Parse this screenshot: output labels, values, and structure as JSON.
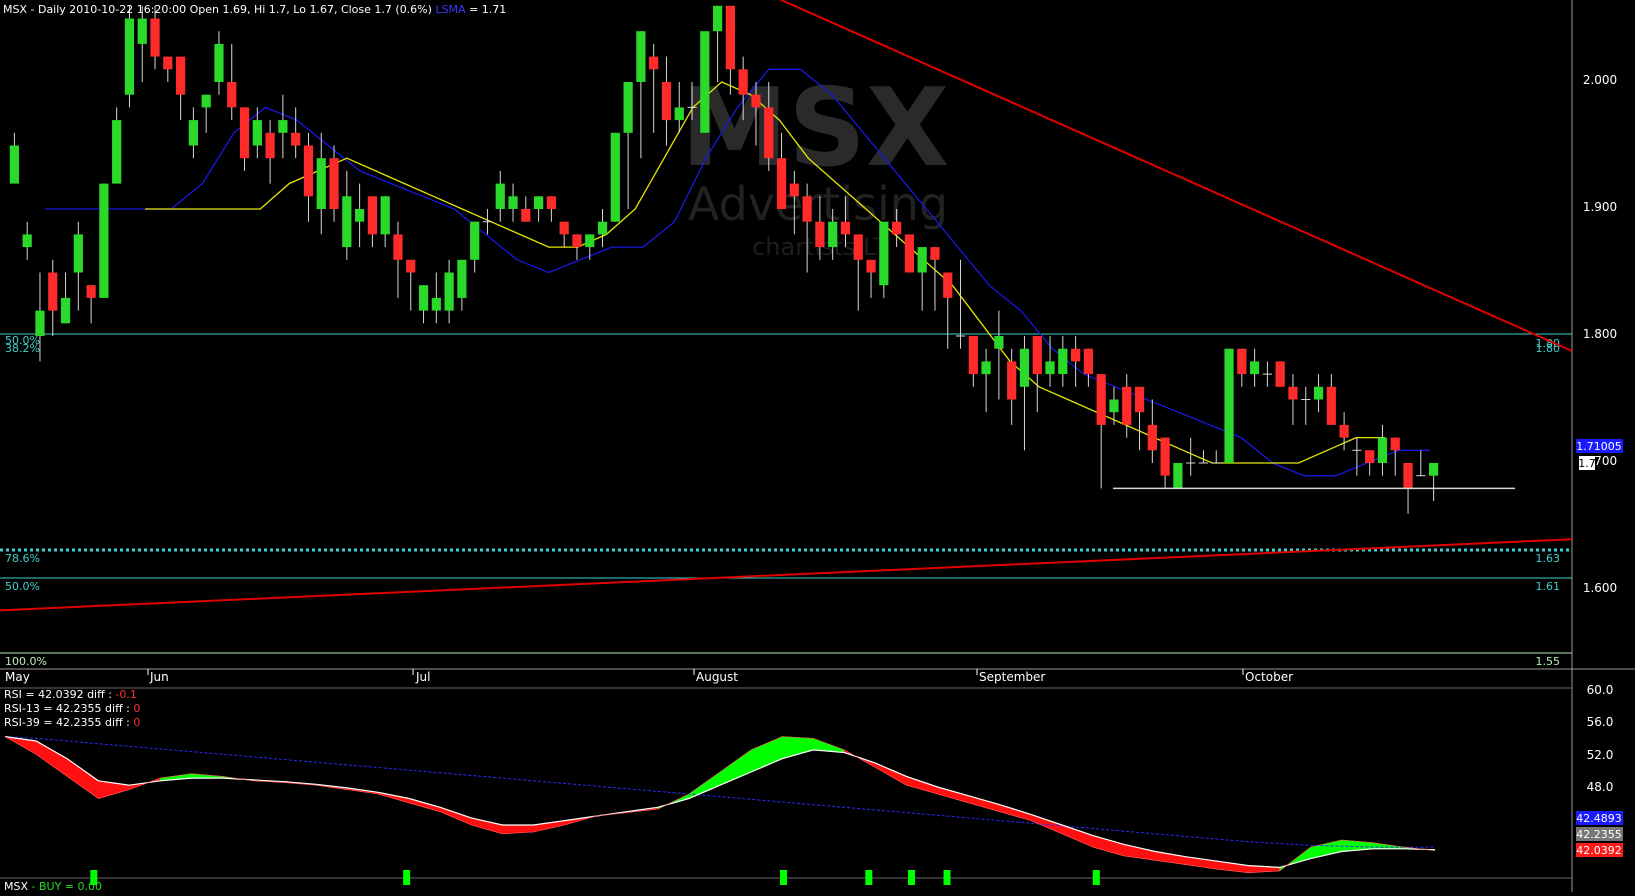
{
  "header": {
    "prefix": "MSX - Daily 2010-10-22 16:20:00 Open 1.69, Hi 1.7, Lo 1.67, Close 1.7 (0.6%)",
    "ma_label": "LSMA",
    "ma_value": "= 1.71"
  },
  "watermark": {
    "ticker": "MSX",
    "company": "Advertising",
    "source": "chartists.LT"
  },
  "colors": {
    "bull": "#2bd92b",
    "bear": "#ff2a2a",
    "ma_slow": "#1818e0",
    "ma_fast": "#e6e600",
    "trend": "#e00000",
    "fib": "#3fd0d0",
    "rsi_up": "#00ff00",
    "rsi_down": "#ff1010"
  },
  "price_axis": {
    "ticks": [
      "2.000",
      "1.900",
      "1.800",
      "1.700",
      "1.600"
    ],
    "badge_ma": "1.71005",
    "badge_close": "1.7"
  },
  "months": [
    "May",
    "Jun",
    "Jul",
    "August",
    "September",
    "October"
  ],
  "fib_levels": [
    {
      "label": "50.0%",
      "label2": "38.2%",
      "value": "1.80"
    },
    {
      "label": "78.6%",
      "value": "1.63"
    },
    {
      "label": "50.0%",
      "value": "1.61"
    },
    {
      "label": "100.0%",
      "value": "1.55"
    }
  ],
  "rsi": {
    "lines": [
      {
        "name": "RSI = 42.0392",
        "diff_label": "diff :",
        "diff": "-0.1"
      },
      {
        "name": "RSI-13 = 42.2355",
        "diff_label": "diff :",
        "diff": "0"
      },
      {
        "name": "RSI-39 = 42.2355",
        "diff_label": "diff :",
        "diff": "0"
      }
    ],
    "ticks": [
      "60.0",
      "56.0",
      "52.0",
      "48.0"
    ],
    "badges": [
      "42.4893",
      "42.2355",
      "42.0392"
    ]
  },
  "footer": {
    "ticker": "MSX",
    "label": "- BUY = 0.00"
  },
  "chart_data": {
    "type": "candlestick",
    "title": "MSX - Daily 2010-10-22 16:20:00",
    "ylim": [
      1.55,
      2.06
    ],
    "candles": [
      [
        1.92,
        1.96,
        1.93,
        1.95
      ],
      [
        1.87,
        1.89,
        1.86,
        1.88
      ],
      [
        1.8,
        1.85,
        1.78,
        1.82
      ],
      [
        1.85,
        1.86,
        1.8,
        1.82
      ],
      [
        1.81,
        1.85,
        1.81,
        1.83
      ],
      [
        1.85,
        1.89,
        1.82,
        1.88
      ],
      [
        1.84,
        1.84,
        1.81,
        1.83
      ],
      [
        1.83,
        1.92,
        1.83,
        1.92
      ],
      [
        1.92,
        1.98,
        1.92,
        1.97
      ],
      [
        1.99,
        2.06,
        1.98,
        2.05
      ],
      [
        2.03,
        2.06,
        2.0,
        2.05
      ],
      [
        2.05,
        2.06,
        2.01,
        2.02
      ],
      [
        2.02,
        2.02,
        2.0,
        2.01
      ],
      [
        2.02,
        2.02,
        1.97,
        1.99
      ],
      [
        1.95,
        1.98,
        1.94,
        1.97
      ],
      [
        1.98,
        1.99,
        1.96,
        1.99
      ],
      [
        2.0,
        2.04,
        1.99,
        2.03
      ],
      [
        2.0,
        2.03,
        1.97,
        1.98
      ],
      [
        1.98,
        1.98,
        1.93,
        1.94
      ],
      [
        1.95,
        1.98,
        1.94,
        1.97
      ],
      [
        1.96,
        1.97,
        1.92,
        1.94
      ],
      [
        1.96,
        1.99,
        1.94,
        1.97
      ],
      [
        1.96,
        1.98,
        1.94,
        1.95
      ],
      [
        1.95,
        1.96,
        1.89,
        1.91
      ],
      [
        1.9,
        1.96,
        1.88,
        1.94
      ],
      [
        1.94,
        1.95,
        1.89,
        1.9
      ],
      [
        1.87,
        1.93,
        1.86,
        1.91
      ],
      [
        1.89,
        1.92,
        1.87,
        1.9
      ],
      [
        1.91,
        1.91,
        1.87,
        1.88
      ],
      [
        1.88,
        1.91,
        1.87,
        1.91
      ],
      [
        1.88,
        1.89,
        1.83,
        1.86
      ],
      [
        1.86,
        1.86,
        1.82,
        1.85
      ],
      [
        1.82,
        1.84,
        1.81,
        1.84
      ],
      [
        1.82,
        1.85,
        1.81,
        1.83
      ],
      [
        1.82,
        1.86,
        1.81,
        1.85
      ],
      [
        1.83,
        1.86,
        1.82,
        1.86
      ],
      [
        1.86,
        1.89,
        1.85,
        1.89
      ],
      [
        1.89,
        1.9,
        1.88,
        1.89
      ],
      [
        1.9,
        1.93,
        1.89,
        1.92
      ],
      [
        1.9,
        1.92,
        1.89,
        1.91
      ],
      [
        1.9,
        1.91,
        1.89,
        1.89
      ],
      [
        1.9,
        1.91,
        1.89,
        1.91
      ],
      [
        1.91,
        1.91,
        1.89,
        1.9
      ],
      [
        1.89,
        1.89,
        1.87,
        1.88
      ],
      [
        1.88,
        1.88,
        1.86,
        1.87
      ],
      [
        1.87,
        1.88,
        1.86,
        1.88
      ],
      [
        1.88,
        1.9,
        1.87,
        1.89
      ],
      [
        1.89,
        1.96,
        1.89,
        1.96
      ],
      [
        1.96,
        1.99,
        1.9,
        2.0
      ],
      [
        2.0,
        2.04,
        1.94,
        2.04
      ],
      [
        2.02,
        2.03,
        1.96,
        2.01
      ],
      [
        2.0,
        2.02,
        1.95,
        1.97
      ],
      [
        1.97,
        2.0,
        1.96,
        1.98
      ],
      [
        1.98,
        2.0,
        1.97,
        1.98
      ],
      [
        1.96,
        2.02,
        1.96,
        2.04
      ],
      [
        2.04,
        2.06,
        2.0,
        2.06
      ],
      [
        2.06,
        2.06,
        1.99,
        2.01
      ],
      [
        2.01,
        2.02,
        1.97,
        1.99
      ],
      [
        1.99,
        2.0,
        1.95,
        1.98
      ],
      [
        1.98,
        2.0,
        1.93,
        1.94
      ],
      [
        1.94,
        1.96,
        1.9,
        1.9
      ],
      [
        1.92,
        1.93,
        1.88,
        1.91
      ],
      [
        1.91,
        1.92,
        1.85,
        1.89
      ],
      [
        1.89,
        1.91,
        1.86,
        1.87
      ],
      [
        1.87,
        1.9,
        1.86,
        1.89
      ],
      [
        1.89,
        1.91,
        1.87,
        1.88
      ],
      [
        1.88,
        1.88,
        1.82,
        1.86
      ],
      [
        1.86,
        1.86,
        1.83,
        1.85
      ],
      [
        1.84,
        1.88,
        1.83,
        1.89
      ],
      [
        1.89,
        1.9,
        1.87,
        1.88
      ],
      [
        1.88,
        1.88,
        1.86,
        1.85
      ],
      [
        1.85,
        1.86,
        1.82,
        1.87
      ],
      [
        1.87,
        1.87,
        1.82,
        1.86
      ],
      [
        1.85,
        1.85,
        1.79,
        1.83
      ],
      [
        1.8,
        1.86,
        1.79,
        1.8
      ],
      [
        1.8,
        1.8,
        1.76,
        1.77
      ],
      [
        1.77,
        1.79,
        1.74,
        1.78
      ],
      [
        1.79,
        1.82,
        1.75,
        1.8
      ],
      [
        1.78,
        1.79,
        1.73,
        1.75
      ],
      [
        1.76,
        1.8,
        1.71,
        1.79
      ],
      [
        1.8,
        1.8,
        1.74,
        1.77
      ],
      [
        1.77,
        1.8,
        1.76,
        1.78
      ],
      [
        1.77,
        1.8,
        1.76,
        1.79
      ],
      [
        1.79,
        1.8,
        1.76,
        1.78
      ],
      [
        1.79,
        1.79,
        1.76,
        1.77
      ],
      [
        1.77,
        1.77,
        1.68,
        1.73
      ],
      [
        1.74,
        1.76,
        1.73,
        1.75
      ],
      [
        1.76,
        1.77,
        1.72,
        1.73
      ],
      [
        1.76,
        1.76,
        1.71,
        1.74
      ],
      [
        1.73,
        1.75,
        1.7,
        1.71
      ],
      [
        1.72,
        1.72,
        1.68,
        1.69
      ],
      [
        1.68,
        1.7,
        1.68,
        1.7
      ],
      [
        1.7,
        1.72,
        1.69,
        1.7
      ],
      [
        1.7,
        1.71,
        1.7,
        1.7
      ],
      [
        1.7,
        1.71,
        1.7,
        1.7
      ],
      [
        1.7,
        1.79,
        1.7,
        1.79
      ],
      [
        1.79,
        1.79,
        1.76,
        1.77
      ],
      [
        1.77,
        1.79,
        1.76,
        1.78
      ],
      [
        1.77,
        1.78,
        1.76,
        1.77
      ],
      [
        1.78,
        1.78,
        1.76,
        1.76
      ],
      [
        1.76,
        1.77,
        1.73,
        1.75
      ],
      [
        1.75,
        1.76,
        1.73,
        1.75
      ],
      [
        1.75,
        1.77,
        1.74,
        1.76
      ],
      [
        1.76,
        1.77,
        1.73,
        1.73
      ],
      [
        1.73,
        1.74,
        1.71,
        1.72
      ],
      [
        1.71,
        1.72,
        1.69,
        1.71
      ],
      [
        1.71,
        1.71,
        1.69,
        1.7
      ],
      [
        1.7,
        1.73,
        1.69,
        1.72
      ],
      [
        1.72,
        1.72,
        1.69,
        1.71
      ],
      [
        1.7,
        1.7,
        1.66,
        1.68
      ],
      [
        1.69,
        1.71,
        1.69,
        1.69
      ],
      [
        1.69,
        1.7,
        1.67,
        1.7
      ]
    ],
    "lsma": [
      1.9,
      1.9,
      1.9,
      1.9,
      1.9,
      1.92,
      1.96,
      1.98,
      1.97,
      1.95,
      1.93,
      1.92,
      1.91,
      1.9,
      1.88,
      1.86,
      1.85,
      1.86,
      1.87,
      1.87,
      1.89,
      1.94,
      1.98,
      2.01,
      2.01,
      1.99,
      1.96,
      1.93,
      1.9,
      1.87,
      1.84,
      1.82,
      1.79,
      1.77,
      1.76,
      1.75,
      1.74,
      1.73,
      1.72,
      1.7,
      1.69,
      1.69,
      1.7,
      1.71,
      1.71
    ],
    "sma": [
      1.9,
      1.9,
      1.9,
      1.9,
      1.9,
      1.92,
      1.93,
      1.94,
      1.93,
      1.92,
      1.91,
      1.9,
      1.89,
      1.88,
      1.87,
      1.87,
      1.88,
      1.9,
      1.94,
      1.98,
      2.0,
      1.99,
      1.97,
      1.94,
      1.92,
      1.9,
      1.88,
      1.86,
      1.84,
      1.81,
      1.78,
      1.76,
      1.75,
      1.74,
      1.73,
      1.72,
      1.71,
      1.7,
      1.7,
      1.7,
      1.7,
      1.71,
      1.72,
      1.72
    ],
    "support": 1.68,
    "trend_down": [
      [
        1.97,
        2.065
      ],
      [
        1.56,
        1.8
      ]
    ],
    "trend_up": [
      [
        0.0,
        1.584
      ],
      [
        1.0,
        1.64
      ]
    ],
    "rsi": [
      55.0,
      53.0,
      50.5,
      48.0,
      49.0,
      50.3,
      50.8,
      50.5,
      50.0,
      49.8,
      49.5,
      49.0,
      48.5,
      47.5,
      46.5,
      45.0,
      44.0,
      44.2,
      45.0,
      46.0,
      46.4,
      46.8,
      48.5,
      51.0,
      53.5,
      55.0,
      54.8,
      53.5,
      51.5,
      49.5,
      48.5,
      47.5,
      46.5,
      45.5,
      44.0,
      42.5,
      41.5,
      41.0,
      40.5,
      40.0,
      39.6,
      39.8,
      42.5,
      43.3,
      43.0,
      42.5,
      42.1
    ],
    "rsi_signal": [
      55.0,
      54.5,
      52.5,
      50.0,
      49.5,
      50.0,
      50.3,
      50.3,
      50.1,
      49.9,
      49.6,
      49.2,
      48.7,
      48.0,
      47.0,
      45.8,
      45.0,
      45.0,
      45.5,
      46.0,
      46.5,
      47.0,
      48.0,
      49.5,
      51.0,
      52.5,
      53.5,
      53.2,
      52.0,
      50.5,
      49.3,
      48.3,
      47.3,
      46.2,
      45.0,
      43.8,
      42.8,
      42.0,
      41.4,
      40.9,
      40.4,
      40.2,
      41.2,
      42.0,
      42.3,
      42.3,
      42.2
    ],
    "rsi_long": [
      55.0,
      54.8,
      54.5,
      54.2,
      53.9,
      53.6,
      53.3,
      53.0,
      52.7,
      52.4,
      52.1,
      51.8,
      51.5,
      51.2,
      50.9,
      50.6,
      50.3,
      50.0,
      49.7,
      49.4,
      49.1,
      48.8,
      48.5,
      48.2,
      47.9,
      47.6,
      47.3,
      47.0,
      46.7,
      46.4,
      46.1,
      45.8,
      45.5,
      45.2,
      44.9,
      44.6,
      44.3,
      44.0,
      43.7,
      43.4,
      43.1,
      42.9,
      42.7,
      42.6,
      42.5,
      42.5,
      42.5
    ],
    "buy_signals": [
      0.06,
      0.28,
      0.545,
      0.605,
      0.635,
      0.66,
      0.765
    ],
    "rsi_range": [
      39,
      60.5
    ]
  }
}
